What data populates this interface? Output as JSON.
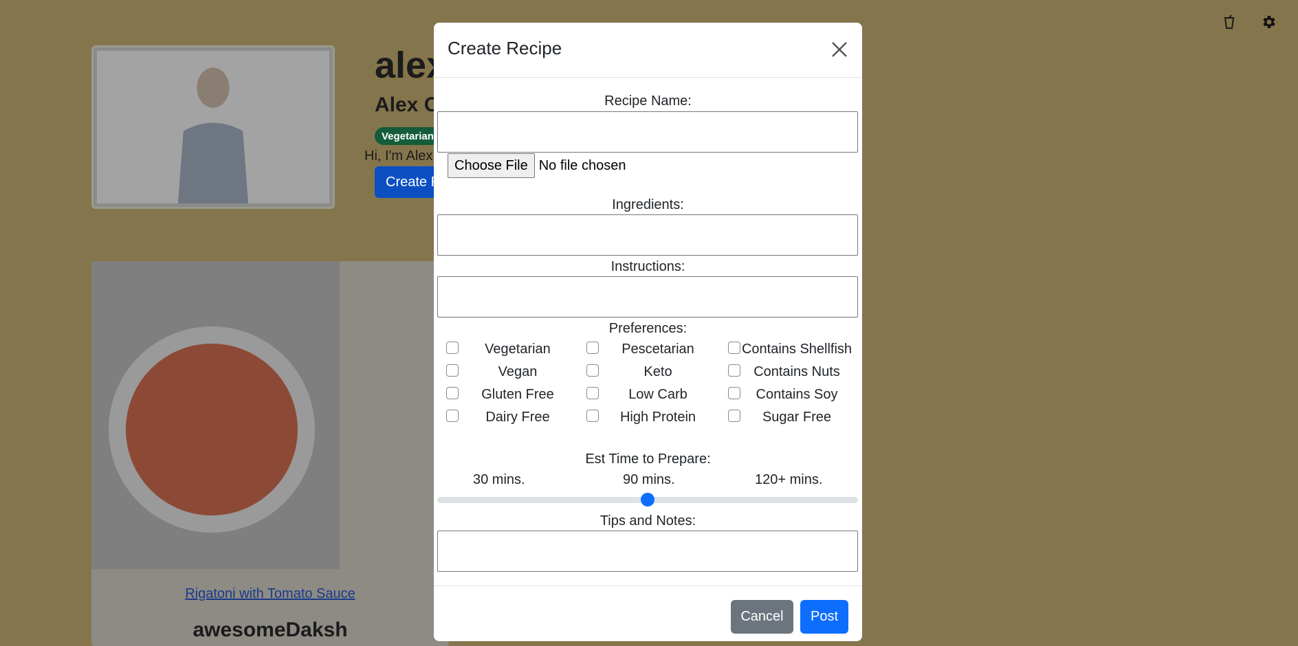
{
  "background": {
    "username": "alex",
    "full_name": "Alex C",
    "preference_badge": "Vegetarian",
    "bio": "Hi, I'm Alex",
    "create_button": "Create R",
    "recipe_card": {
      "title": "Rigatoni with Tomato Sauce",
      "author": "awesomeDaksh"
    },
    "icons": [
      "cup-icon",
      "gear-icon"
    ]
  },
  "modal": {
    "title": "Create Recipe",
    "fields": {
      "recipe_name_label": "Recipe Name:",
      "recipe_name_value": "",
      "file_button": "Choose File",
      "file_status": "No file chosen",
      "ingredients_label": "Ingredients:",
      "ingredients_value": "",
      "instructions_label": "Instructions:",
      "instructions_value": "",
      "preferences_label": "Preferences:",
      "tips_label": "Tips and Notes:",
      "tips_value": ""
    },
    "preferences": {
      "col1": [
        {
          "label": "Vegetarian",
          "checked": false
        },
        {
          "label": "Vegan",
          "checked": false
        },
        {
          "label": "Gluten Free",
          "checked": false
        },
        {
          "label": "Dairy Free",
          "checked": false
        }
      ],
      "col2": [
        {
          "label": "Pescetarian",
          "checked": false
        },
        {
          "label": "Keto",
          "checked": false
        },
        {
          "label": "Low Carb",
          "checked": false
        },
        {
          "label": "High Protein",
          "checked": false
        }
      ],
      "col3": [
        {
          "label": "Contains Shellfish",
          "checked": false
        },
        {
          "label": "Contains Nuts",
          "checked": false
        },
        {
          "label": "Contains Soy",
          "checked": false
        },
        {
          "label": "Sugar Free",
          "checked": false
        }
      ]
    },
    "time": {
      "label": "Est Time to Prepare:",
      "marks": [
        "30 mins.",
        "90 mins.",
        "120+ mins."
      ],
      "value_fraction": 0.5
    },
    "buttons": {
      "cancel": "Cancel",
      "post": "Post"
    }
  },
  "colors": {
    "backdrop": "#84754c",
    "primary": "#0d6efd",
    "secondary": "#6c757d",
    "badge_green": "#145c3a"
  }
}
